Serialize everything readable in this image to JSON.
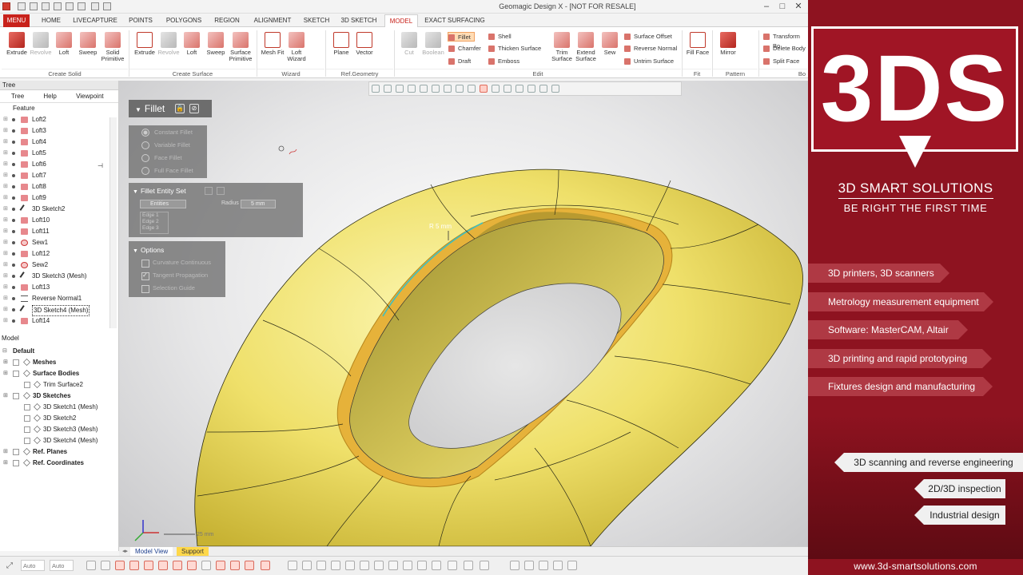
{
  "window": {
    "title": "Geomagic Design X - [NOT FOR RESALE]",
    "minimize": "–",
    "maximize": "□",
    "close": "✕"
  },
  "tabs": [
    "MENU",
    "HOME",
    "LIVECAPTURE",
    "POINTS",
    "POLYGONS",
    "REGION",
    "ALIGNMENT",
    "SKETCH",
    "3D SKETCH",
    "MODEL",
    "EXACT SURFACING"
  ],
  "ribbon": {
    "create_solid": {
      "label": "Create Solid",
      "buttons": [
        "Extrude",
        "Revolve",
        "Loft",
        "Sweep",
        "Solid Primitive"
      ]
    },
    "create_surface": {
      "label": "Create Surface",
      "buttons": [
        "Extrude",
        "Revolve",
        "Loft",
        "Sweep",
        "Surface Primitive"
      ]
    },
    "wizard": {
      "label": "Wizard",
      "buttons": [
        "Mesh Fit",
        "Loft Wizard"
      ]
    },
    "ref_geometry": {
      "label": "Ref.Geometry",
      "buttons": [
        "Plane",
        "Vector"
      ]
    },
    "edit": {
      "label": "Edit",
      "buttons": [
        "Cut",
        "Boolean",
        "Trim Surface",
        "Extend Surface",
        "Sew"
      ],
      "small": [
        "Fillet",
        "Chamfer",
        "Draft",
        "Shell",
        "Thicken Surface",
        "Emboss",
        "Surface Offset",
        "Reverse Normal",
        "Untrim Surface"
      ]
    },
    "fit": {
      "label": "Fit",
      "buttons": [
        "Fill Face"
      ]
    },
    "pattern": {
      "label": "Pattern",
      "buttons": [
        "Mirror"
      ]
    },
    "body": {
      "label": "Bo",
      "small": [
        "Transform Bo",
        "Delete Body",
        "Split Face"
      ]
    }
  },
  "tree": {
    "title": "Tree",
    "tabs": [
      "Tree",
      "Help",
      "Viewpoint"
    ],
    "feature_label": "Feature",
    "items": [
      {
        "label": "Loft2",
        "icon": "loft-icon"
      },
      {
        "label": "Loft3",
        "icon": "loft-icon"
      },
      {
        "label": "Loft4",
        "icon": "loft-icon"
      },
      {
        "label": "Loft5",
        "icon": "loft-icon"
      },
      {
        "label": "Loft6",
        "icon": "loft-icon"
      },
      {
        "label": "Loft7",
        "icon": "loft-icon"
      },
      {
        "label": "Loft8",
        "icon": "loft-icon"
      },
      {
        "label": "Loft9",
        "icon": "loft-icon"
      },
      {
        "label": "3D Sketch2",
        "icon": "sketch-icon"
      },
      {
        "label": "Loft10",
        "icon": "loft-icon"
      },
      {
        "label": "Loft11",
        "icon": "loft-icon"
      },
      {
        "label": "Sew1",
        "icon": "sew-icon"
      },
      {
        "label": "Loft12",
        "icon": "loft-icon"
      },
      {
        "label": "Sew2",
        "icon": "sew-icon"
      },
      {
        "label": "3D Sketch3 (Mesh)",
        "icon": "sketch-icon"
      },
      {
        "label": "Loft13",
        "icon": "loft-icon"
      },
      {
        "label": "Reverse Normal1",
        "icon": "reverse-normal-icon"
      },
      {
        "label": "3D Sketch4 (Mesh)",
        "icon": "sketch-icon",
        "selected": true
      },
      {
        "label": "Loft14",
        "icon": "loft-icon"
      }
    ]
  },
  "model": {
    "title": "Model",
    "default_label": "Default",
    "items": [
      {
        "label": "Meshes",
        "bold": true,
        "level": 1
      },
      {
        "label": "Surface Bodies",
        "bold": true,
        "level": 1
      },
      {
        "label": "Trim Surface2",
        "bold": false,
        "level": 2
      },
      {
        "label": "3D Sketches",
        "bold": true,
        "level": 1
      },
      {
        "label": "3D Sketch1 (Mesh)",
        "bold": false,
        "level": 2
      },
      {
        "label": "3D Sketch2",
        "bold": false,
        "level": 2
      },
      {
        "label": "3D Sketch3 (Mesh)",
        "bold": false,
        "level": 2
      },
      {
        "label": "3D Sketch4 (Mesh)",
        "bold": false,
        "level": 2
      },
      {
        "label": "Ref. Planes",
        "bold": true,
        "level": 1
      },
      {
        "label": "Ref. Coordinates",
        "bold": true,
        "level": 1
      }
    ]
  },
  "fillet": {
    "title": "Fillet",
    "methods": [
      "Constant Fillet",
      "Variable Fillet",
      "Face Fillet",
      "Full Face Fillet"
    ],
    "entity_set_title": "Fillet Entity Set",
    "entities_label": "Entities",
    "radius_label": "Radius",
    "radius_value": "5 mm",
    "edges": [
      "Edge 1",
      "Edge 2",
      "Edge 3"
    ],
    "options_title": "Options",
    "options": [
      {
        "label": "Curvature Continuous",
        "checked": false
      },
      {
        "label": "Tangent Propagation",
        "checked": true
      },
      {
        "label": "Selection Guide",
        "checked": false
      }
    ]
  },
  "viewport": {
    "radius_annotation": "R 5 mm",
    "scale_label": "25 mm",
    "model_color": "#f2e87a"
  },
  "viewtabs": [
    "Model View",
    "Support"
  ],
  "status": {
    "select_mode": "Auto",
    "filter_mode": "Auto"
  },
  "ad": {
    "logo": "3DS",
    "title": "3D SMART SOLUTIONS",
    "slogan": "BE RIGHT THE FIRST TIME",
    "services": [
      "3D printers, 3D scanners",
      "Metrology measurement equipment",
      "Software: MasterCAM, Altair",
      "3D printing and rapid prototyping",
      "Fixtures design and manufacturing"
    ],
    "services2": [
      "3D scanning and reverse engineering",
      "2D/3D inspection",
      "Industrial design"
    ],
    "url": "www.3d-smartsolutions.com",
    "brand_color": "#a01525"
  }
}
